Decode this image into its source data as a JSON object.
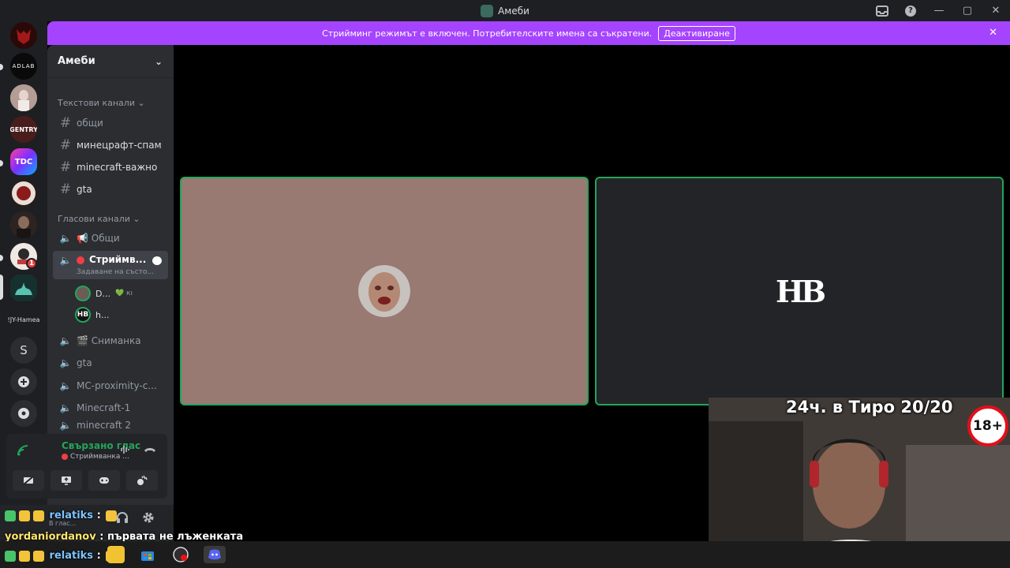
{
  "window": {
    "title": "Амеби"
  },
  "notice": {
    "text": "Стрийминг режимът е включен. Потребителските имена са съкратени.",
    "button_label": "Деактивиране"
  },
  "server": {
    "name": "Амеби",
    "rail_text_label": "!JY-Hamea",
    "rail_letter": "S",
    "rail_badge": "1"
  },
  "categories": {
    "text": "Текстови канали",
    "voice": "Гласови канали"
  },
  "text_channels": [
    {
      "name": "общи"
    },
    {
      "name": "минецрафт-спам"
    },
    {
      "name": "minecraft-важно"
    },
    {
      "name": "gta"
    }
  ],
  "voice_channels": [
    {
      "name": "📢 Общи"
    },
    {
      "name": "Стриймв...",
      "subtitle": "Задаване на състо..."
    },
    {
      "name": "🎬 Сниманка"
    },
    {
      "name": "gta"
    },
    {
      "name": "MC-proximity-c..."
    },
    {
      "name": "Minecraft-1"
    },
    {
      "name": "minecraft 2"
    }
  ],
  "voice_members": [
    {
      "name": "D...",
      "tag": "💚 кı"
    },
    {
      "name": "h...",
      "avatar": "HB"
    }
  ],
  "voice_panel": {
    "status": "Свързано глас",
    "channel": "Стриймванка ..."
  },
  "user_bar": {
    "sub": "В глас..."
  },
  "stage": {
    "tile2_logo": "HB"
  },
  "webcam": {
    "title": "24ч. в Тиро 20/20",
    "age_badge": "18+"
  },
  "chat_overlay": [
    {
      "user": "relatiks",
      "sep": ":",
      "message": ""
    },
    {
      "user": "yordaniordanov",
      "sep": ":",
      "message": "първата не лъженката"
    },
    {
      "user": "relatiks",
      "sep": ":",
      "message": ""
    }
  ],
  "icons": {
    "settings": "gear-icon",
    "headphones": "headphones-icon",
    "disconnect": "phone-hangup-icon"
  },
  "colors": {
    "accent_notice": "#a544ff",
    "connected_green": "#23a55a",
    "live_red": "#f23f43"
  }
}
